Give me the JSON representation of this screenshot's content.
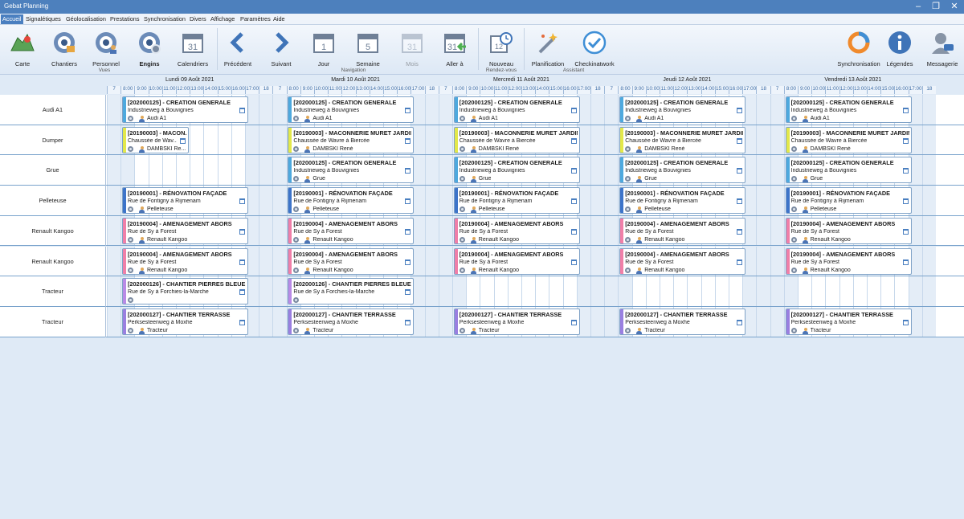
{
  "window": {
    "title": "Gebat Planning"
  },
  "menu": [
    "Accueil",
    "Signalétiques",
    "Géolocalisation",
    "Prestations",
    "Synchronisation",
    "Divers",
    "Affichage",
    "Paramètres",
    "Aide"
  ],
  "ribbon": {
    "views_group": "Vues",
    "navigation_group": "Navigation",
    "rdv_group": "Rendez-vous",
    "assistant_group": "Assistant",
    "buttons": {
      "carte": "Carte",
      "chantiers": "Chantiers",
      "personnel": "Personnel",
      "engins": "Engins",
      "calendriers": "Calendriers",
      "precedent": "Précédent",
      "suivant": "Suivant",
      "jour": "Jour",
      "semaine": "Semaine",
      "mois": "Mois",
      "aller": "Aller à",
      "nouveau": "Nouveau",
      "planification": "Planification",
      "checkinatwork": "Checkinatwork",
      "synchronisation": "Synchronisation",
      "legendes": "Légendes",
      "messagerie": "Messagerie"
    },
    "calendar_icons": {
      "jour": "1",
      "semaine": "5",
      "mois": "31",
      "aller": "31",
      "calendriers": "31",
      "nouveau": "12"
    }
  },
  "days": [
    "Lundi 09 Août 2021",
    "Mardi 10 Août 2021",
    "Mercredi 11 Août 2021",
    "Jeudi 12 Août 2021",
    "Vendredi 13 Août 2021"
  ],
  "hours": [
    "7",
    "8:00",
    "9:00",
    "10:00",
    "11:00",
    "12:00",
    "13:00",
    "14:00",
    "15:00",
    "16:00",
    "17:00",
    "18"
  ],
  "rows": [
    "Audi A1",
    "Dumper",
    "Grue",
    "Pelleteuse",
    "Renault Kangoo",
    "Renault Kangoo",
    "Tracteur",
    "Tracteur"
  ],
  "colors": {
    "blue": "#4ea9de",
    "yellow": "#e3e84a",
    "darkblue": "#3d74c9",
    "pink": "#f07fa8",
    "purple": "#b98ae6",
    "violet": "#9a7fe0",
    "accent": "#4a7fc0"
  },
  "cards": [
    {
      "row": 0,
      "days": [
        0,
        1,
        2,
        3,
        4
      ],
      "color": "blue",
      "title": "[202000125] - CREATION GENERALE",
      "address": "Industrieweg à Bouvignies",
      "resource": "Audi A1"
    },
    {
      "row": 1,
      "days": [
        0
      ],
      "color": "yellow",
      "narrow": true,
      "title": "[20190003] - MACON...",
      "address": "Chaussée de Wav...",
      "resource": "DAMBSKI Re..."
    },
    {
      "row": 1,
      "days": [
        1,
        2,
        3,
        4
      ],
      "color": "yellow",
      "title": "[20190003] - MACONNERIE MURET JARDIN",
      "address": "Chaussée de Wavre à Biercée",
      "resource": "DAMBSKI René"
    },
    {
      "row": 2,
      "days": [
        1,
        2,
        3,
        4
      ],
      "color": "blue",
      "title": "[202000125] - CREATION GENERALE",
      "address": "Industrieweg à Bouvignies",
      "resource": "Grue"
    },
    {
      "row": 3,
      "days": [
        0,
        1,
        2,
        3,
        4
      ],
      "color": "darkblue",
      "title": "[20190001] - RÉNOVATION FAÇADE",
      "address": "Rue de Fontigny à Rijmenam",
      "resource": "Pelleteuse"
    },
    {
      "row": 4,
      "days": [
        0,
        1,
        2,
        3,
        4
      ],
      "color": "pink",
      "title": "[20190004] - AMENAGEMENT ABORS",
      "address": "Rue de Sy à Forest",
      "resource": "Renault Kangoo"
    },
    {
      "row": 5,
      "days": [
        0,
        1,
        2,
        3,
        4
      ],
      "color": "pink",
      "title": "[20190004] - AMENAGEMENT ABORS",
      "address": "Rue de Sy à Forest",
      "resource": "Renault Kangoo"
    },
    {
      "row": 6,
      "days": [
        0,
        1
      ],
      "color": "purple",
      "title": "[202000126] - CHANTIER PIERRES BLEUE",
      "address": "Rue de Sy à Forchies-la-Marche",
      "resource": ""
    },
    {
      "row": 7,
      "days": [
        0,
        1,
        2,
        3,
        4
      ],
      "color": "violet",
      "title": "[202000127] - CHANTIER TERRASSE",
      "address": "Perksesteenweg à Moxhe",
      "resource": "Tracteur"
    }
  ]
}
